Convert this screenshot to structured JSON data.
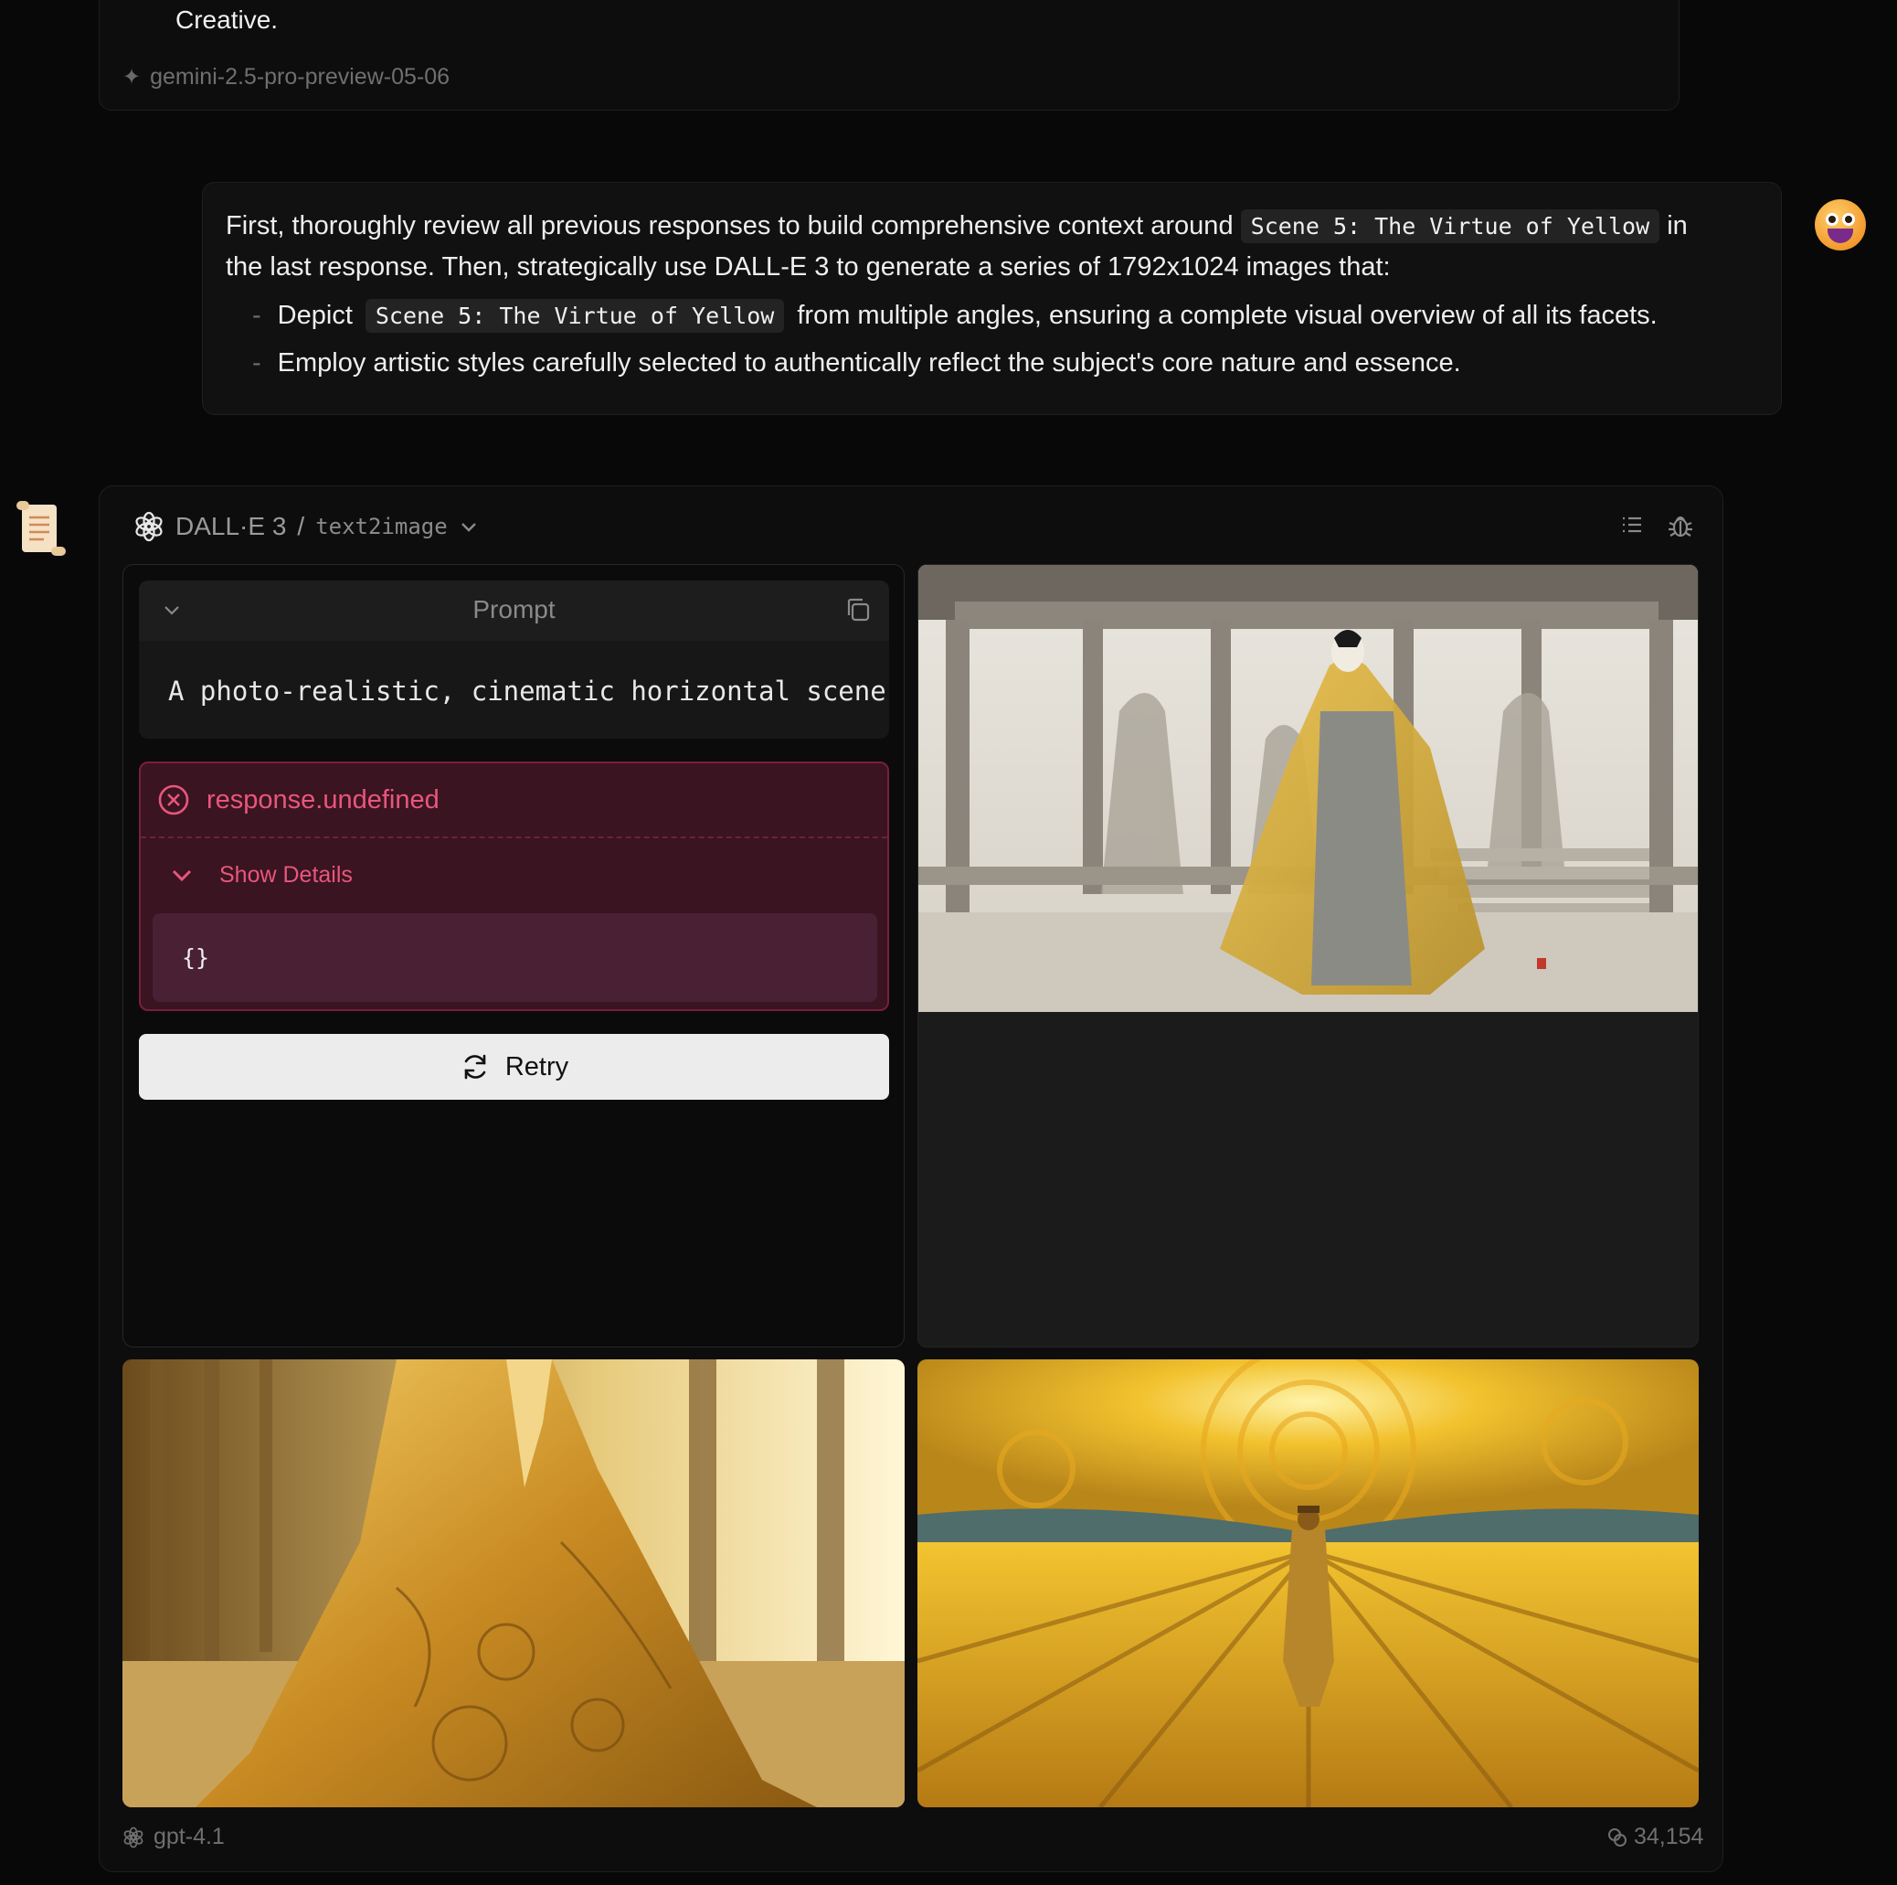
{
  "previous_message": {
    "text_tail": "Creative.",
    "model": "gemini-2.5-pro-preview-05-06"
  },
  "user_message": {
    "line1_prefix": "First, thoroughly review all previous responses to build comprehensive context around",
    "scene_code": "Scene 5: The Virtue of Yellow",
    "line1_suffix": "in",
    "line2": "the last response. Then, strategically use DALL-E 3 to generate a series of 1792x1024 images that:",
    "bullet1_prefix": "Depict",
    "bullet1_code": "Scene 5: The Virtue of Yellow",
    "bullet1_suffix": "from multiple angles, ensuring a complete visual overview of all its facets.",
    "bullet2": "Employ artistic styles carefully selected to authentically reflect the subject's core nature and essence.",
    "bullet_dash": "-"
  },
  "assistant": {
    "tool_name": "DALL·E 3",
    "separator": "/",
    "tool_mode": "text2image",
    "prompt_label": "Prompt",
    "prompt_text": "A photo-realistic, cinematic horizontal scene f",
    "error_title": "response.undefined",
    "show_details_label": "Show Details",
    "error_code": "{}",
    "retry_label": "Retry",
    "images": [
      {
        "name": "ink-painting-yellow-robe-palace"
      },
      {
        "name": "golden-gown-baroque-hall"
      },
      {
        "name": "impressionist-golden-field"
      }
    ],
    "footer_model": "gpt-4.1",
    "footer_tokens": "34,154"
  },
  "colors": {
    "background": "#080808",
    "error_bg": "#3a1420",
    "error_text": "#e8567e",
    "retry_bg": "#ececec"
  },
  "icons": [
    "sparkle-icon",
    "avatar-smiley",
    "scroll-icon",
    "openai-logo-icon",
    "chevron-down-icon",
    "list-icon",
    "bug-icon",
    "copy-icon",
    "error-circle-x-icon",
    "refresh-icon",
    "token-icon"
  ]
}
